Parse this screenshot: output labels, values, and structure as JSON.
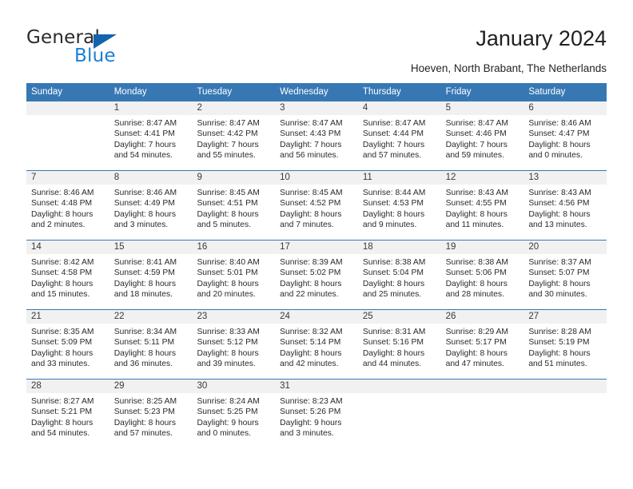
{
  "brand": {
    "name_part1": "General",
    "name_part2": "Blue",
    "triangle_color": "#1464ad",
    "blue_color": "#1a7fd4"
  },
  "header": {
    "title": "January 2024",
    "subtitle": "Hoeven, North Brabant, The Netherlands"
  },
  "theme": {
    "header_blue": "#3778b4",
    "daynum_band": "#f1f1f1",
    "text": "#2a2a2a"
  },
  "calendar": {
    "weekday_headers": [
      "Sunday",
      "Monday",
      "Tuesday",
      "Wednesday",
      "Thursday",
      "Friday",
      "Saturday"
    ],
    "weeks": [
      [
        {
          "day": "",
          "sunrise": "",
          "sunset": "",
          "daylight_line1": "",
          "daylight_line2": ""
        },
        {
          "day": "1",
          "sunrise": "Sunrise: 8:47 AM",
          "sunset": "Sunset: 4:41 PM",
          "daylight_line1": "Daylight: 7 hours",
          "daylight_line2": "and 54 minutes."
        },
        {
          "day": "2",
          "sunrise": "Sunrise: 8:47 AM",
          "sunset": "Sunset: 4:42 PM",
          "daylight_line1": "Daylight: 7 hours",
          "daylight_line2": "and 55 minutes."
        },
        {
          "day": "3",
          "sunrise": "Sunrise: 8:47 AM",
          "sunset": "Sunset: 4:43 PM",
          "daylight_line1": "Daylight: 7 hours",
          "daylight_line2": "and 56 minutes."
        },
        {
          "day": "4",
          "sunrise": "Sunrise: 8:47 AM",
          "sunset": "Sunset: 4:44 PM",
          "daylight_line1": "Daylight: 7 hours",
          "daylight_line2": "and 57 minutes."
        },
        {
          "day": "5",
          "sunrise": "Sunrise: 8:47 AM",
          "sunset": "Sunset: 4:46 PM",
          "daylight_line1": "Daylight: 7 hours",
          "daylight_line2": "and 59 minutes."
        },
        {
          "day": "6",
          "sunrise": "Sunrise: 8:46 AM",
          "sunset": "Sunset: 4:47 PM",
          "daylight_line1": "Daylight: 8 hours",
          "daylight_line2": "and 0 minutes."
        }
      ],
      [
        {
          "day": "7",
          "sunrise": "Sunrise: 8:46 AM",
          "sunset": "Sunset: 4:48 PM",
          "daylight_line1": "Daylight: 8 hours",
          "daylight_line2": "and 2 minutes."
        },
        {
          "day": "8",
          "sunrise": "Sunrise: 8:46 AM",
          "sunset": "Sunset: 4:49 PM",
          "daylight_line1": "Daylight: 8 hours",
          "daylight_line2": "and 3 minutes."
        },
        {
          "day": "9",
          "sunrise": "Sunrise: 8:45 AM",
          "sunset": "Sunset: 4:51 PM",
          "daylight_line1": "Daylight: 8 hours",
          "daylight_line2": "and 5 minutes."
        },
        {
          "day": "10",
          "sunrise": "Sunrise: 8:45 AM",
          "sunset": "Sunset: 4:52 PM",
          "daylight_line1": "Daylight: 8 hours",
          "daylight_line2": "and 7 minutes."
        },
        {
          "day": "11",
          "sunrise": "Sunrise: 8:44 AM",
          "sunset": "Sunset: 4:53 PM",
          "daylight_line1": "Daylight: 8 hours",
          "daylight_line2": "and 9 minutes."
        },
        {
          "day": "12",
          "sunrise": "Sunrise: 8:43 AM",
          "sunset": "Sunset: 4:55 PM",
          "daylight_line1": "Daylight: 8 hours",
          "daylight_line2": "and 11 minutes."
        },
        {
          "day": "13",
          "sunrise": "Sunrise: 8:43 AM",
          "sunset": "Sunset: 4:56 PM",
          "daylight_line1": "Daylight: 8 hours",
          "daylight_line2": "and 13 minutes."
        }
      ],
      [
        {
          "day": "14",
          "sunrise": "Sunrise: 8:42 AM",
          "sunset": "Sunset: 4:58 PM",
          "daylight_line1": "Daylight: 8 hours",
          "daylight_line2": "and 15 minutes."
        },
        {
          "day": "15",
          "sunrise": "Sunrise: 8:41 AM",
          "sunset": "Sunset: 4:59 PM",
          "daylight_line1": "Daylight: 8 hours",
          "daylight_line2": "and 18 minutes."
        },
        {
          "day": "16",
          "sunrise": "Sunrise: 8:40 AM",
          "sunset": "Sunset: 5:01 PM",
          "daylight_line1": "Daylight: 8 hours",
          "daylight_line2": "and 20 minutes."
        },
        {
          "day": "17",
          "sunrise": "Sunrise: 8:39 AM",
          "sunset": "Sunset: 5:02 PM",
          "daylight_line1": "Daylight: 8 hours",
          "daylight_line2": "and 22 minutes."
        },
        {
          "day": "18",
          "sunrise": "Sunrise: 8:38 AM",
          "sunset": "Sunset: 5:04 PM",
          "daylight_line1": "Daylight: 8 hours",
          "daylight_line2": "and 25 minutes."
        },
        {
          "day": "19",
          "sunrise": "Sunrise: 8:38 AM",
          "sunset": "Sunset: 5:06 PM",
          "daylight_line1": "Daylight: 8 hours",
          "daylight_line2": "and 28 minutes."
        },
        {
          "day": "20",
          "sunrise": "Sunrise: 8:37 AM",
          "sunset": "Sunset: 5:07 PM",
          "daylight_line1": "Daylight: 8 hours",
          "daylight_line2": "and 30 minutes."
        }
      ],
      [
        {
          "day": "21",
          "sunrise": "Sunrise: 8:35 AM",
          "sunset": "Sunset: 5:09 PM",
          "daylight_line1": "Daylight: 8 hours",
          "daylight_line2": "and 33 minutes."
        },
        {
          "day": "22",
          "sunrise": "Sunrise: 8:34 AM",
          "sunset": "Sunset: 5:11 PM",
          "daylight_line1": "Daylight: 8 hours",
          "daylight_line2": "and 36 minutes."
        },
        {
          "day": "23",
          "sunrise": "Sunrise: 8:33 AM",
          "sunset": "Sunset: 5:12 PM",
          "daylight_line1": "Daylight: 8 hours",
          "daylight_line2": "and 39 minutes."
        },
        {
          "day": "24",
          "sunrise": "Sunrise: 8:32 AM",
          "sunset": "Sunset: 5:14 PM",
          "daylight_line1": "Daylight: 8 hours",
          "daylight_line2": "and 42 minutes."
        },
        {
          "day": "25",
          "sunrise": "Sunrise: 8:31 AM",
          "sunset": "Sunset: 5:16 PM",
          "daylight_line1": "Daylight: 8 hours",
          "daylight_line2": "and 44 minutes."
        },
        {
          "day": "26",
          "sunrise": "Sunrise: 8:29 AM",
          "sunset": "Sunset: 5:17 PM",
          "daylight_line1": "Daylight: 8 hours",
          "daylight_line2": "and 47 minutes."
        },
        {
          "day": "27",
          "sunrise": "Sunrise: 8:28 AM",
          "sunset": "Sunset: 5:19 PM",
          "daylight_line1": "Daylight: 8 hours",
          "daylight_line2": "and 51 minutes."
        }
      ],
      [
        {
          "day": "28",
          "sunrise": "Sunrise: 8:27 AM",
          "sunset": "Sunset: 5:21 PM",
          "daylight_line1": "Daylight: 8 hours",
          "daylight_line2": "and 54 minutes."
        },
        {
          "day": "29",
          "sunrise": "Sunrise: 8:25 AM",
          "sunset": "Sunset: 5:23 PM",
          "daylight_line1": "Daylight: 8 hours",
          "daylight_line2": "and 57 minutes."
        },
        {
          "day": "30",
          "sunrise": "Sunrise: 8:24 AM",
          "sunset": "Sunset: 5:25 PM",
          "daylight_line1": "Daylight: 9 hours",
          "daylight_line2": "and 0 minutes."
        },
        {
          "day": "31",
          "sunrise": "Sunrise: 8:23 AM",
          "sunset": "Sunset: 5:26 PM",
          "daylight_line1": "Daylight: 9 hours",
          "daylight_line2": "and 3 minutes."
        },
        {
          "day": "",
          "sunrise": "",
          "sunset": "",
          "daylight_line1": "",
          "daylight_line2": ""
        },
        {
          "day": "",
          "sunrise": "",
          "sunset": "",
          "daylight_line1": "",
          "daylight_line2": ""
        },
        {
          "day": "",
          "sunrise": "",
          "sunset": "",
          "daylight_line1": "",
          "daylight_line2": ""
        }
      ]
    ]
  }
}
